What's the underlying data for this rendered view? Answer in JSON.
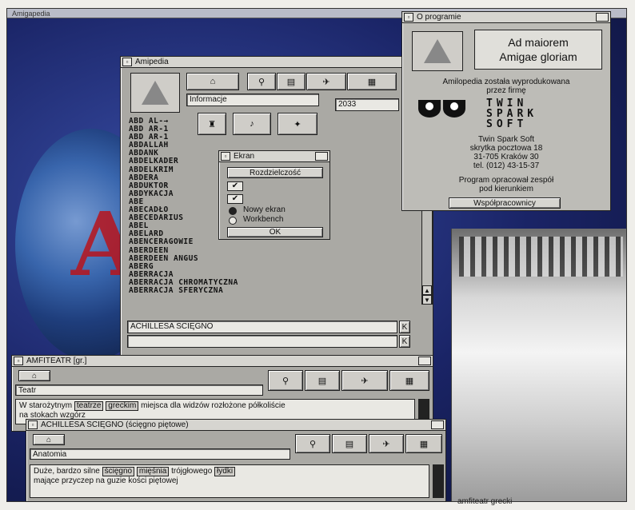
{
  "screen": {
    "title": "Amigapedia"
  },
  "main_window": {
    "title": "Amipedia",
    "tab_label": "Informacje",
    "year_value": "2033",
    "entries": [
      "ABD AL-→",
      "ABD AR-1",
      "ABD AR-1",
      "ABDALLAH",
      "ABDANK",
      "ABDELKADER",
      "ABDELKRIM",
      "ABDERA",
      "ABDUKTOR",
      "ABDYKACJA",
      "ABE",
      "ABECADŁO",
      "ABECEDARIUS",
      "ABEL",
      "ABELARD",
      "ABENCERAGOWIE",
      "ABERDEEN",
      "ABERDEEN ANGUS",
      "ABERG",
      "ABERRACJA",
      "ABERRACJA CHROMATYCZNA",
      "ABERRACJA SFERYCZNA"
    ],
    "search_value": "ACHILLESA SCIĘGNO"
  },
  "screen_dialog": {
    "title": "Ekran",
    "resolution_button": "Rozdzielczość",
    "option_new_screen": "Nowy ekran",
    "option_workbench": "Workbench",
    "ok_button": "OK"
  },
  "about_window": {
    "title": "O programie",
    "motto_line1": "Ad maiorem",
    "motto_line2": "Amigae gloriam",
    "intro_line1": "Amilopedia została wyprodukowana",
    "intro_line2": "przez firmę",
    "brand_word1": "TWIN",
    "brand_word2": "SPARK",
    "brand_word3": "SOFT",
    "company_name": "Twin Spark Soft",
    "address_line1": "skrytka pocztowa 18",
    "address_line2": "31-705 Kraków 30",
    "phone": "tel. (012) 43-15-37",
    "credits_line1": "Program opracował zespół",
    "credits_line2": "pod kierunkiem",
    "bottom_button": "Współpracownicy"
  },
  "amfiteatr_window": {
    "title": "AMFITEATR [gr.]",
    "category": "Teatr",
    "text_prefix": "W starożytnym",
    "link1": "teatrze",
    "link2": "greckim",
    "text_suffix": "miejsca dla widzów rozłożone półkoliście",
    "text_line2": "na stokach wzgórz"
  },
  "achilles_window": {
    "title": "ACHILLESA ŚCIĘGNO (ścięgno piętowe)",
    "category": "Anatomia",
    "text_prefix": "Duże, bardzo silne",
    "link1": "ścięgno",
    "link2": "mięśnia",
    "text_middle": "trójgłowego",
    "link3": "łydki",
    "text_line2": "mające przyczep na guzie kości piętowej"
  },
  "photo_caption": "amfiteatr grecki",
  "colors": {
    "window_bg": "#aaa9a4",
    "titlebar": "#d6d5d0",
    "screen_bg": "#1a2466",
    "accent_red": "#b8141c"
  }
}
